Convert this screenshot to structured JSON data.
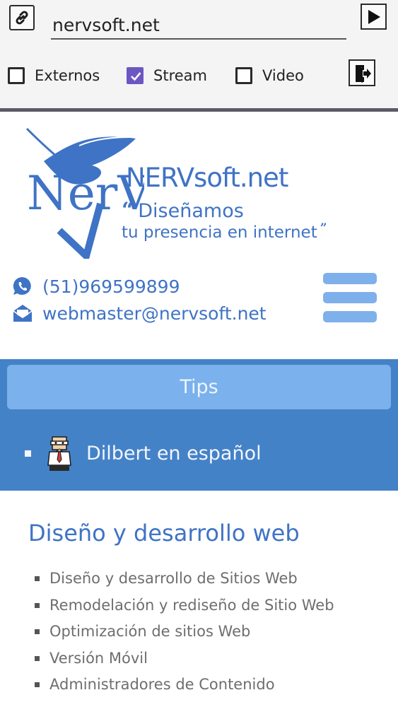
{
  "toolbar": {
    "url_value": "nervsoft.net",
    "checkboxes": [
      {
        "label": "Externos",
        "checked": false
      },
      {
        "label": "Stream",
        "checked": true
      },
      {
        "label": "Video",
        "checked": false
      }
    ],
    "accent_color": "#6c57c2"
  },
  "header": {
    "logo_text": "NerV",
    "brand_name": "NERVsoft.net",
    "quote_open": "“",
    "quote_line1": "Diseñamos",
    "quote_line2": "tu presencia en internet",
    "quote_close": "”",
    "phone": "(51)969599899",
    "email": "webmaster@nervsoft.net",
    "brand_color": "#3f73c5"
  },
  "nav": {
    "tips_label": "Tips",
    "items": [
      {
        "label": "Dilbert en español"
      }
    ],
    "panel_color": "#4482c8"
  },
  "services": {
    "title": "Diseño y desarrollo web",
    "items": [
      "Diseño y desarrollo de Sitios Web",
      "Remodelación y rediseño de Sitio Web",
      "Optimización de sitios Web",
      "Versión Móvil",
      "Administradores de Contenido"
    ]
  }
}
